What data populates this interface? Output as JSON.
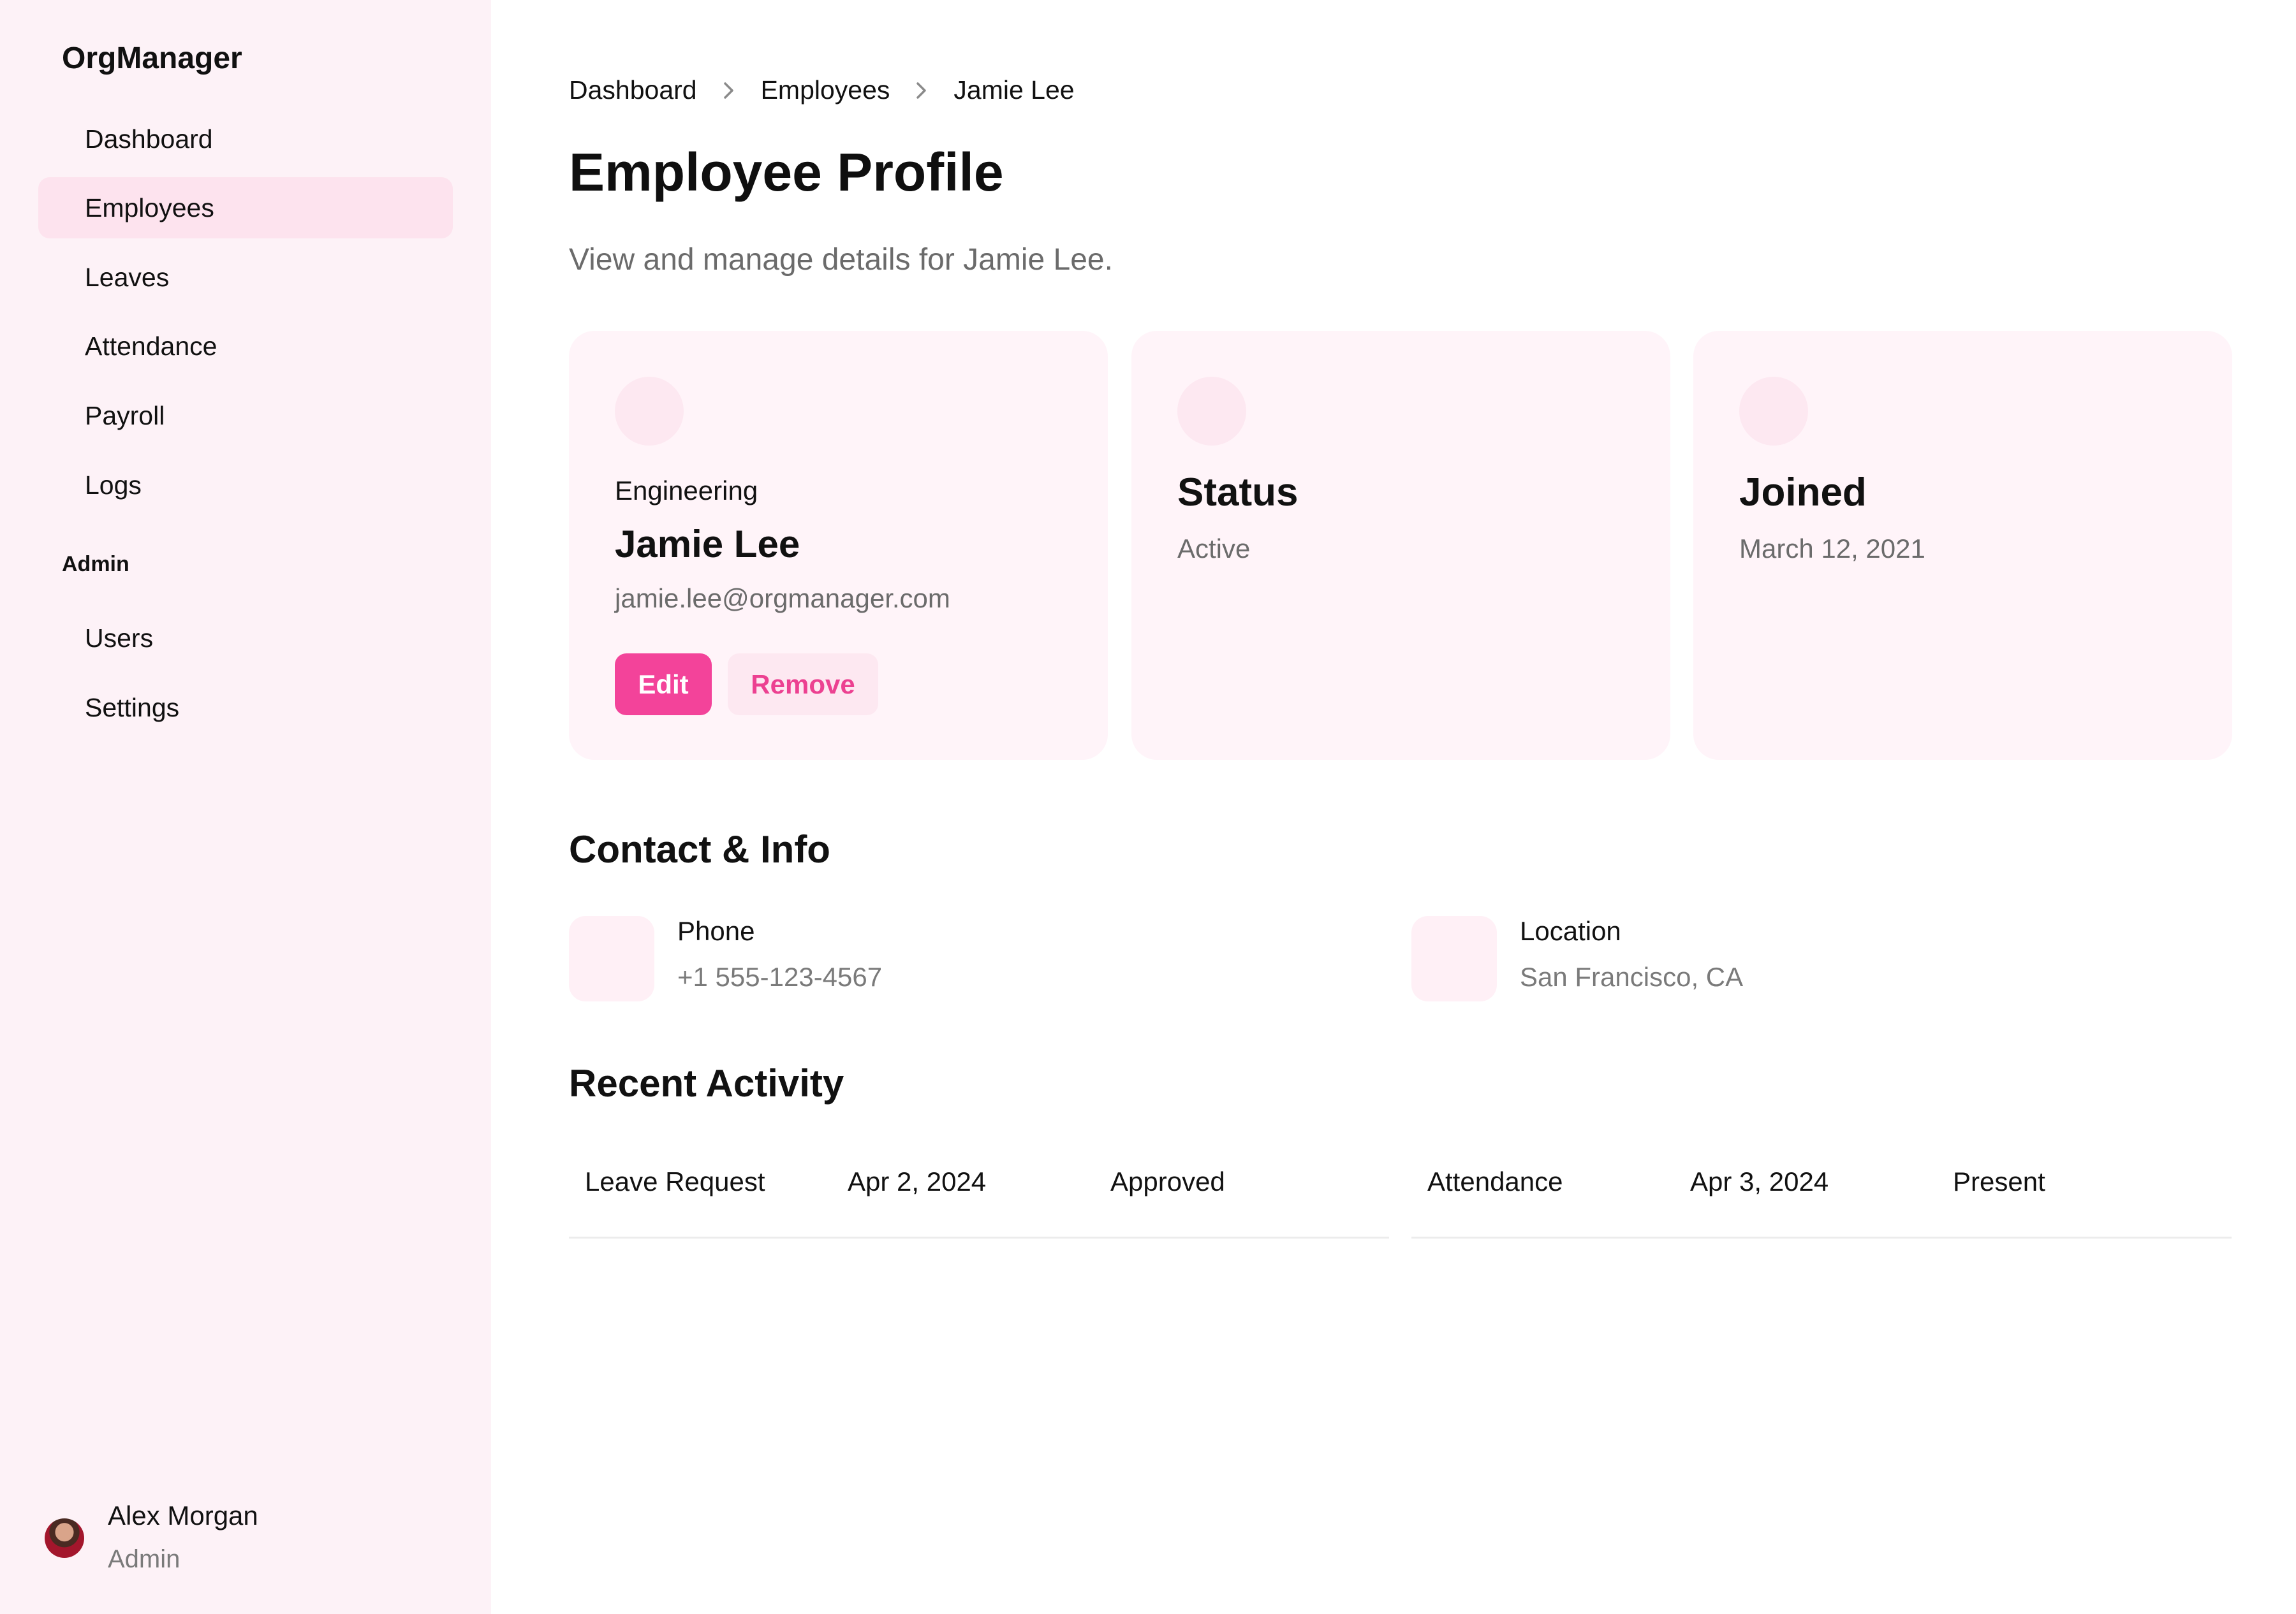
{
  "app": {
    "name": "OrgManager"
  },
  "sidebar": {
    "items": [
      {
        "label": "Dashboard"
      },
      {
        "label": "Employees"
      },
      {
        "label": "Leaves"
      },
      {
        "label": "Attendance"
      },
      {
        "label": "Payroll"
      },
      {
        "label": "Logs"
      }
    ],
    "admin_section": {
      "title": "Admin",
      "items": [
        {
          "label": "Users"
        },
        {
          "label": "Settings"
        }
      ]
    },
    "user": {
      "name": "Alex Morgan",
      "role": "Admin"
    }
  },
  "breadcrumb": {
    "items": [
      {
        "label": "Dashboard"
      },
      {
        "label": "Employees"
      },
      {
        "label": "Jamie Lee"
      }
    ]
  },
  "page": {
    "title": "Employee Profile",
    "subtitle": "View and manage details for Jamie Lee."
  },
  "profile_card": {
    "department": "Engineering",
    "name": "Jamie Lee",
    "email": "jamie.lee@orgmanager.com",
    "edit_label": "Edit",
    "remove_label": "Remove"
  },
  "status_card": {
    "title": "Status",
    "value": "Active"
  },
  "joined_card": {
    "title": "Joined",
    "value": "March 12, 2021"
  },
  "contact": {
    "title": "Contact & Info",
    "items": [
      {
        "label": "Phone",
        "value": "+1 555-123-4567"
      },
      {
        "label": "Location",
        "value": "San Francisco, CA"
      }
    ]
  },
  "activity": {
    "title": "Recent Activity",
    "rows": [
      {
        "type": "Leave Request",
        "date": "Apr 2, 2024",
        "status": "Approved"
      },
      {
        "type": "Attendance",
        "date": "Apr 3, 2024",
        "status": "Present"
      }
    ]
  },
  "colors": {
    "sidebar_bg": "#fdf2f7",
    "active_nav": "#fde3ee",
    "accent": "#f3439a",
    "card_bg": "#fff4f9"
  }
}
